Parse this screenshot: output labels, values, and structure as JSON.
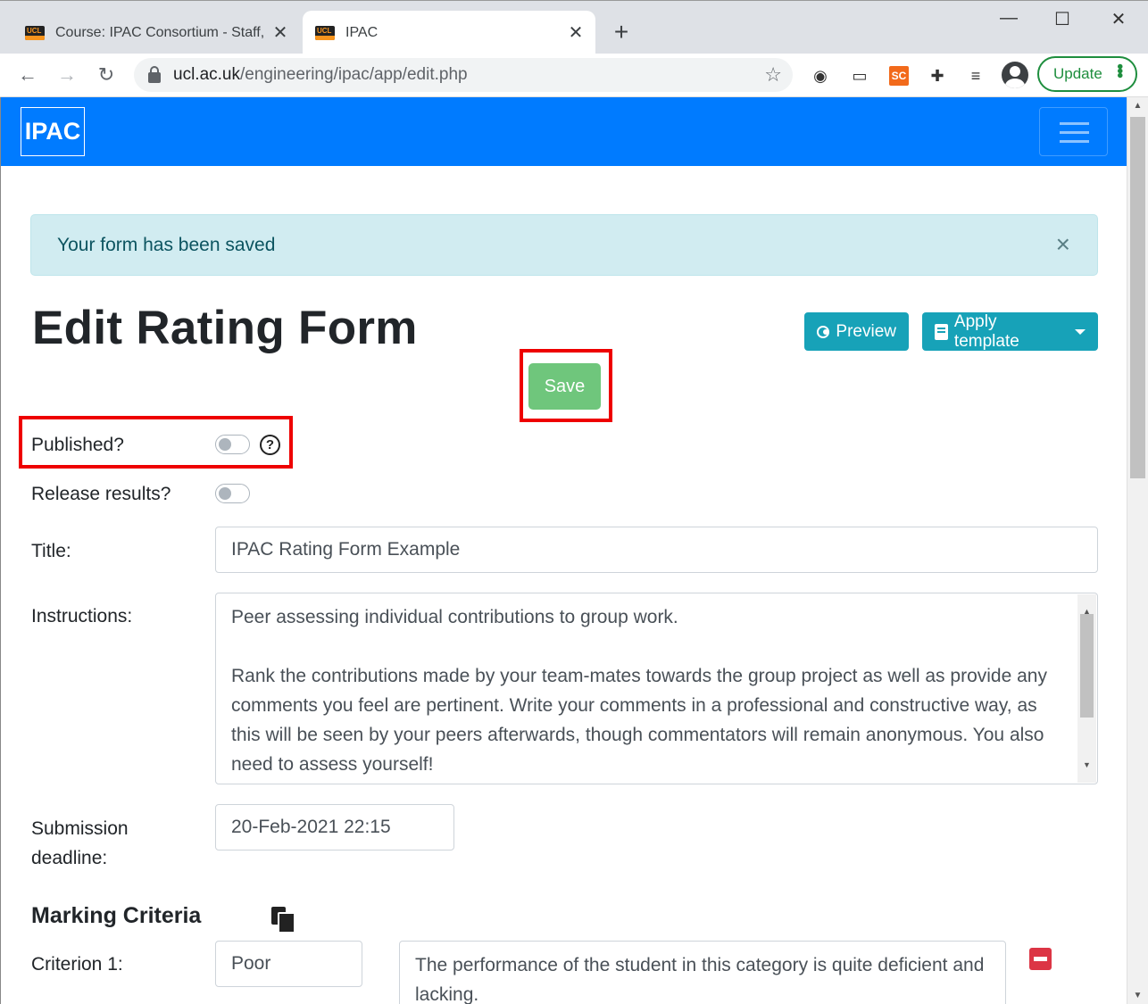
{
  "browser": {
    "tabs": [
      {
        "title": "Course: IPAC Consortium - Staff,",
        "favicon": "UCL"
      },
      {
        "title": "IPAC",
        "favicon": "UCL"
      }
    ],
    "url_domain": "ucl.ac.uk",
    "url_path": "/engineering/ipac/app/edit.php",
    "update_label": "Update",
    "extension_sc": "SC"
  },
  "app": {
    "brand": "IPAC"
  },
  "alert": {
    "message": "Your form has been saved",
    "close": "×"
  },
  "page": {
    "title": "Edit Rating Form",
    "preview_label": "Preview",
    "apply_template_label": "Apply template",
    "save_label": "Save"
  },
  "form": {
    "published_label": "Published?",
    "published": false,
    "release_label": "Release results?",
    "release": false,
    "help": "?",
    "title_label": "Title:",
    "title_value": "IPAC Rating Form Example",
    "instructions_label": "Instructions:",
    "instructions_p1": "Peer assessing individual contributions to group work.",
    "instructions_p2": "Rank the contributions made by your team-mates towards the group project as well as provide any comments you feel are pertinent.  Write your comments in a professional and constructive way, as this will be seen by your peers afterwards, though commentators will remain anonymous.  You also need to assess yourself!",
    "deadline_label_1": "Submission",
    "deadline_label_2": "deadline:",
    "deadline_value": "20-Feb-2021 22:15"
  },
  "criteria": {
    "heading": "Marking Criteria",
    "items": [
      {
        "label": "Criterion 1:",
        "name": "Poor",
        "description": "The performance of the student in this category is quite deficient and lacking."
      }
    ]
  },
  "colors": {
    "navbar": "#007bff",
    "info_button": "#17a2b8",
    "save_button": "#6fc67c",
    "alert_bg": "#d1ecf1",
    "highlight": "#ee0000"
  }
}
